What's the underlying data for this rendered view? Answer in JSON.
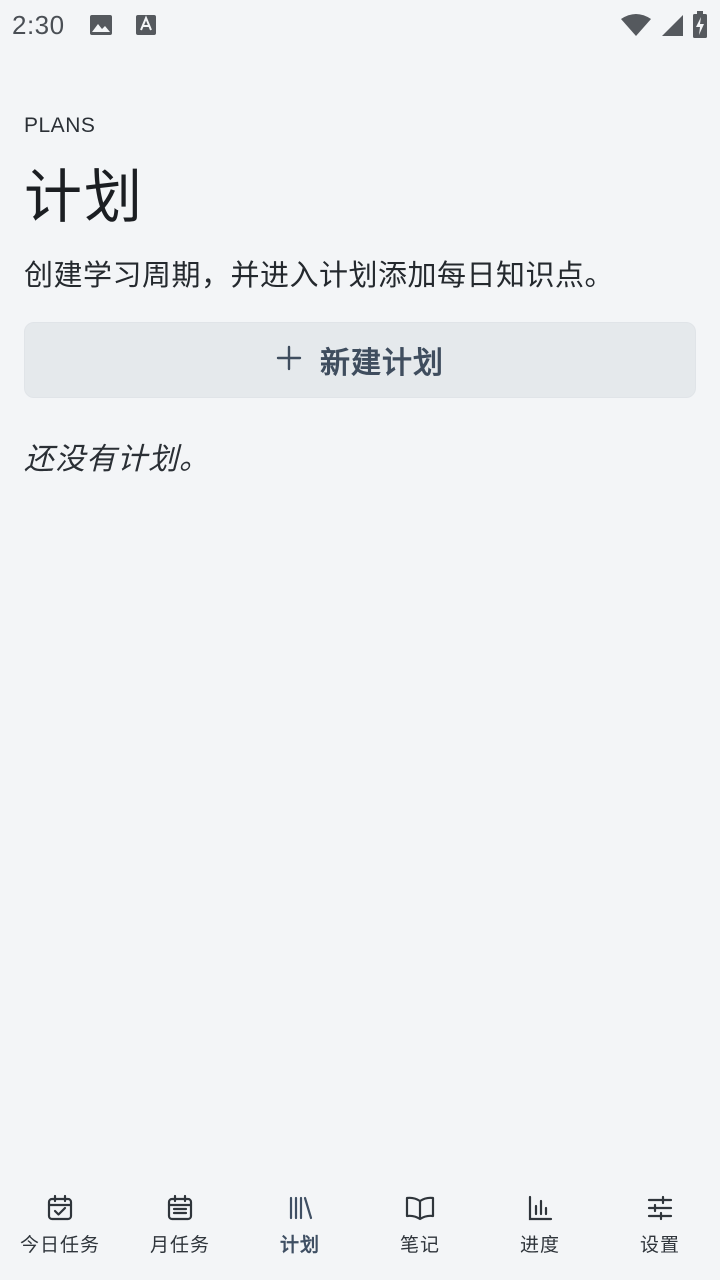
{
  "status_bar": {
    "time": "2:30",
    "left_icons": [
      "image-icon",
      "font-a-icon"
    ],
    "right_icons": [
      "wifi-icon",
      "cell-signal-icon",
      "battery-charging-icon"
    ]
  },
  "header": {
    "eyebrow": "PLANS",
    "title": "计划",
    "subtitle": "创建学习周期，并进入计划添加每日知识点。"
  },
  "actions": {
    "new_plan_label": "新建计划",
    "new_plan_icon": "plus-icon"
  },
  "empty_state": {
    "text": "还没有计划。"
  },
  "bottom_nav": {
    "active_index": 2,
    "items": [
      {
        "label": "今日任务",
        "icon": "calendar-check-icon"
      },
      {
        "label": "月任务",
        "icon": "calendar-list-icon"
      },
      {
        "label": "计划",
        "icon": "library-icon"
      },
      {
        "label": "笔记",
        "icon": "book-open-icon"
      },
      {
        "label": "进度",
        "icon": "bar-chart-icon"
      },
      {
        "label": "设置",
        "icon": "sliders-icon"
      }
    ]
  },
  "colors": {
    "background": "#f3f5f7",
    "button_bg": "#e5e9ec",
    "accent": "#3f4d5e",
    "text": "#1d2126"
  }
}
